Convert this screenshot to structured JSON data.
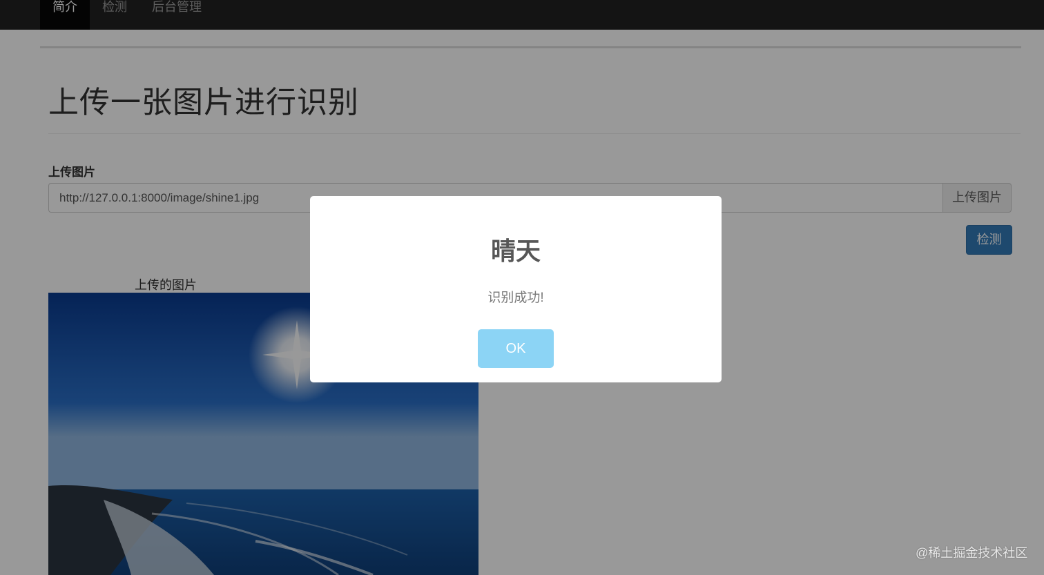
{
  "nav": {
    "items": [
      {
        "label": "简介",
        "active": true
      },
      {
        "label": "检测",
        "active": false
      },
      {
        "label": "后台管理",
        "active": false
      }
    ]
  },
  "page": {
    "title": "上传一张图片进行识别",
    "field_label": "上传图片",
    "url_value": "http://127.0.0.1:8000/image/shine1.jpg",
    "upload_button": "上传图片",
    "detect_button": "检测",
    "image_caption": "上传的图片"
  },
  "modal": {
    "title": "晴天",
    "text": "识别成功!",
    "ok_button": "OK",
    "ok_color": "#8cd4f5"
  },
  "watermark": "@稀土掘金技术社区",
  "colors": {
    "navbar": "#222222",
    "primary": "#337ab7"
  }
}
